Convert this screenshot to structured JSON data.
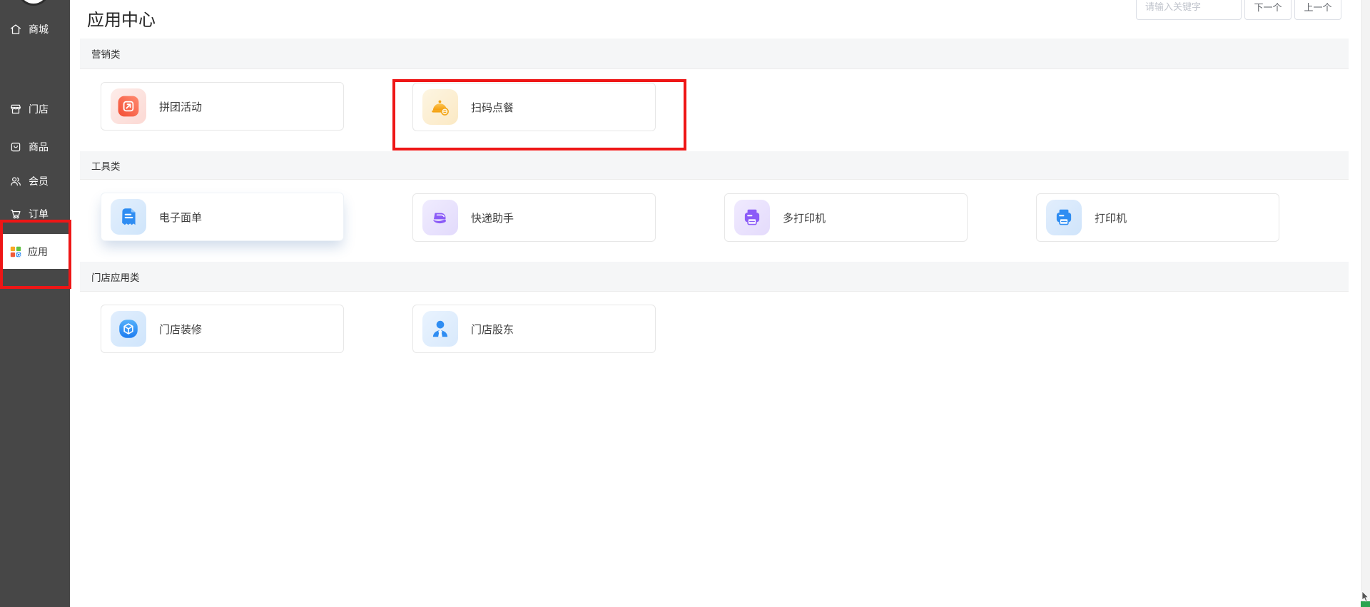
{
  "sidebar": {
    "items": [
      {
        "label": "商城",
        "icon": "home-icon"
      },
      {
        "label": "门店",
        "icon": "store-icon"
      },
      {
        "label": "商品",
        "icon": "goods-icon"
      },
      {
        "label": "会员",
        "icon": "members-icon"
      },
      {
        "label": "订单",
        "icon": "cart-icon"
      },
      {
        "label": "应用",
        "icon": "apps-grid-icon",
        "active": true
      }
    ]
  },
  "header": {
    "title": "应用中心",
    "search_placeholder": "请输入关键字",
    "next_label": "下一个",
    "prev_label": "上一个"
  },
  "sections": [
    {
      "title": "营销类",
      "apps": [
        {
          "name": "拼团活动",
          "icon": "groupbuy-icon"
        },
        {
          "name": "扫码点餐",
          "icon": "scan-order-icon",
          "annotated": true
        }
      ]
    },
    {
      "title": "工具类",
      "apps": [
        {
          "name": "电子面单",
          "icon": "ewaybill-icon",
          "elevated": true
        },
        {
          "name": "快递助手",
          "icon": "express-helper-icon"
        },
        {
          "name": "多打印机",
          "icon": "multi-printer-icon"
        },
        {
          "name": "打印机",
          "icon": "printer-icon"
        }
      ]
    },
    {
      "title": "门店应用类",
      "apps": [
        {
          "name": "门店装修",
          "icon": "store-decoration-icon"
        },
        {
          "name": "门店股东",
          "icon": "store-shareholder-icon"
        }
      ]
    }
  ],
  "colors": {
    "sidebar_bg": "#474747",
    "annotation_red": "#ee1616",
    "section_bg": "#f5f6f7",
    "accent_blue": "#2f8df2",
    "accent_purple": "#8b5bf7",
    "accent_orange": "#f4a516",
    "accent_red": "#f34f35",
    "corner_green": "#2aa44f"
  }
}
